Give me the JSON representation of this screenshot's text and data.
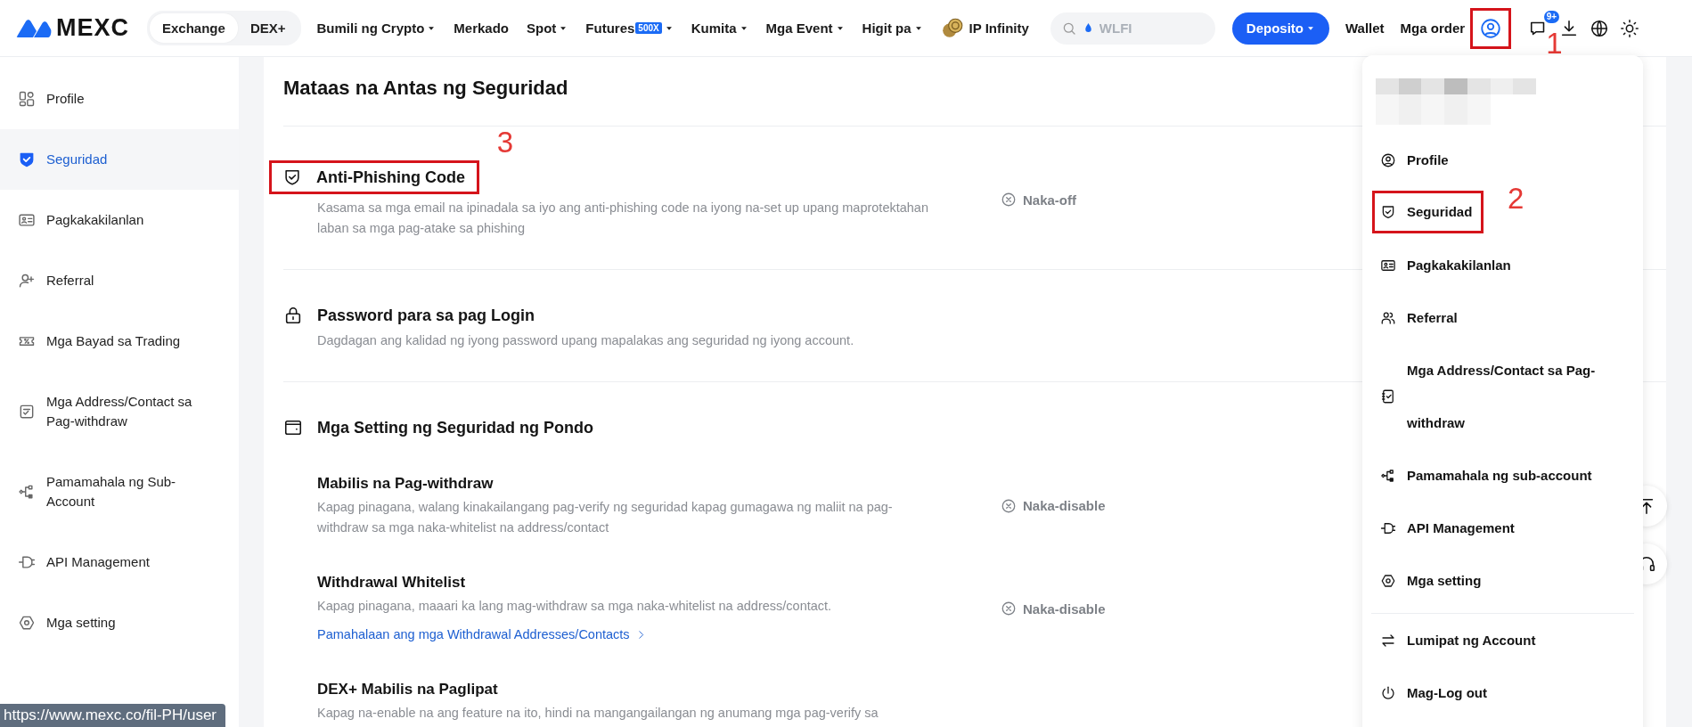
{
  "nav": {
    "logo": "MEXC",
    "switch": [
      {
        "label": "Exchange",
        "selected": true
      },
      {
        "label": "DEX+",
        "selected": false
      }
    ],
    "menu": [
      {
        "label": "Bumili ng Crypto",
        "dropdown": true
      },
      {
        "label": "Merkado",
        "dropdown": false
      },
      {
        "label": "Spot",
        "dropdown": true
      },
      {
        "label": "Futures",
        "badge": "500X",
        "dropdown": true
      },
      {
        "label": "Kumita",
        "dropdown": true
      },
      {
        "label": "Mga Event",
        "dropdown": true
      },
      {
        "label": "Higit pa",
        "dropdown": true
      },
      {
        "label": "IP Infinity",
        "dropdown": false,
        "coin": true
      }
    ],
    "search": {
      "placeholder": "WLFI"
    },
    "deposit": "Deposito",
    "links": [
      "Wallet",
      "Mga order"
    ],
    "user_button": {
      "annotation": "1"
    },
    "notification_badge": "9+"
  },
  "sidebar": {
    "items": [
      {
        "label": "Profile",
        "selected": false
      },
      {
        "label": "Seguridad",
        "selected": true
      },
      {
        "label": "Pagkakakilanlan",
        "selected": false
      },
      {
        "label": "Referral",
        "selected": false
      },
      {
        "label": "Mga Bayad sa Trading",
        "selected": false
      },
      {
        "label": "Mga Address/Contact sa Pag-withdraw",
        "selected": false
      },
      {
        "label": "Pamamahala ng Sub-Account",
        "selected": false
      },
      {
        "label": "API Management",
        "selected": false
      },
      {
        "label": "Mga setting",
        "selected": false
      }
    ]
  },
  "content": {
    "title": "Mataas na Antas ng Seguridad",
    "sections": [
      {
        "title": "Anti-Phishing Code",
        "description": "Kasama sa mga email na ipinadala sa iyo ang anti-phishing code na iyong na-set up upang maprotektahan laban sa mga pag-atake sa phishing",
        "status": "Naka-off",
        "annotation": "3"
      },
      {
        "title": "Password para sa pag Login",
        "description": "Dagdagan ang kalidad ng iyong password upang mapalakas ang seguridad ng iyong account."
      },
      {
        "title": "Mga Setting ng Seguridad ng Pondo",
        "items": [
          {
            "title": "Mabilis na Pag-withdraw",
            "description": "Kapag pinagana, walang kinakailangang pag-verify ng seguridad kapag gumagawa ng maliit na pag-withdraw sa mga naka-whitelist na address/contact",
            "status": "Naka-disable"
          },
          {
            "title": "Withdrawal Whitelist",
            "description": "Kapag pinagana, maaari ka lang mag-withdraw sa mga naka-whitelist na address/contact.",
            "status": "Naka-disable",
            "link": "Pamahalaan ang mga Withdrawal Addresses/Contacts"
          },
          {
            "title": "DEX+ Mabilis na Paglipat",
            "description": "Kapag na-enable na ang feature na ito, hindi na mangangailangan ng anumang mga pag-verify sa"
          }
        ]
      }
    ]
  },
  "account_menu": {
    "items": [
      {
        "label": "Profile"
      },
      {
        "label": "Seguridad",
        "annotation": "2"
      },
      {
        "label": "Pagkakakilanlan"
      },
      {
        "label": "Referral"
      },
      {
        "label": "Mga Address/Contact sa Pag-withdraw"
      },
      {
        "label": "Pamamahala ng sub-account"
      },
      {
        "label": "API Management"
      },
      {
        "label": "Mga setting"
      }
    ],
    "account_items": [
      {
        "label": "Lumipat ng Account"
      },
      {
        "label": "Mag-Log out"
      }
    ]
  },
  "status_url": "https://www.mexc.co/fil-PH/user"
}
